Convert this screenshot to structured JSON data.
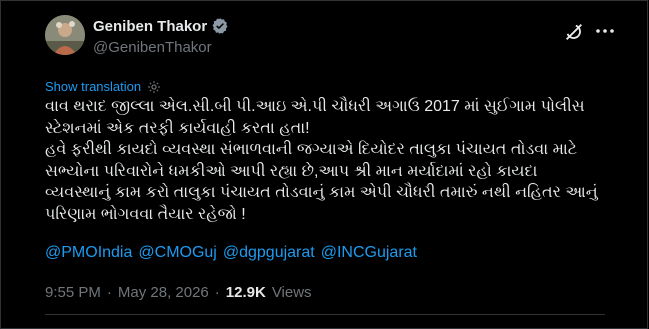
{
  "author": {
    "name": "Geniben Thakor",
    "handle": "@GenibenThakor"
  },
  "icons": {
    "verified": "verified-badge-icon",
    "grok": "grok-icon",
    "more": "more-icon",
    "settings": "gear-icon"
  },
  "colors": {
    "background": "#000000",
    "text": "#e7e9ea",
    "secondary": "#71767b",
    "accent": "#1d9bf0"
  },
  "tweet": {
    "show_translation": "Show translation",
    "text": "વાવ થરાદ જીલ્લા એલ.સી.બી પી.આઇ એ.પી ચૌધરી અગાઉ 2017 માં સુઈગામ પોલીસ સ્ટેશનમાં એક તરફી કાર્યવાહી કરતા હતા!\n હવે ફરીથી કાયદો વ્યવસ્થા સંભાળવાની જગ્યાએ દિયોદર તાલુકા પંચાયત તોડવા માટે સભ્યોના પરિવારોને ધમકીઓ આપી રહ્યા છે,આપ શ્રી માન મર્યાદામાં રહો કાયદા વ્યવસ્થાનું કામ કરો તાલુકા પંચાયત તોડવાનું કામ એપી ચૌધરી તમારું નથી નહિતર આનું પરિણામ ભોગવવા તૈયાર રહેજો !",
    "mentions": [
      "@PMOIndia",
      "@CMOGuj",
      "@dgpgujarat",
      "@INCGujarat"
    ]
  },
  "meta": {
    "time": "9:55 PM",
    "separator": "·",
    "date": "May 28, 2026",
    "views_count": "12.9K",
    "views_label": "Views"
  }
}
